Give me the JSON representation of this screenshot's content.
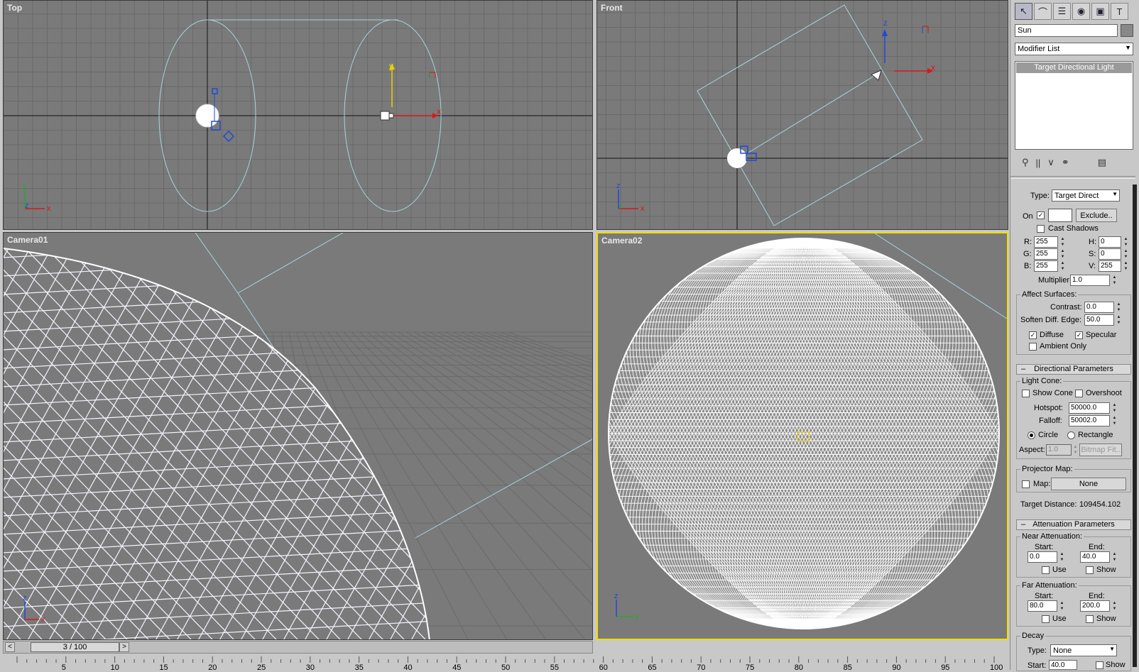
{
  "viewports": {
    "top": {
      "label": "Top"
    },
    "front": {
      "label": "Front"
    },
    "camera01": {
      "label": "Camera01"
    },
    "camera02": {
      "label": "Camera02"
    }
  },
  "axes": {
    "x": "x",
    "y": "y",
    "z": "z"
  },
  "command_panel": {
    "tabs": [
      "create-icon",
      "modify-icon",
      "hierarchy-icon",
      "motion-icon",
      "display-icon",
      "utilities-icon"
    ],
    "object_name": "Sun",
    "modifier_list": "Modifier List",
    "stack_item": "Target Directional Light"
  },
  "general_params": {
    "type_label": "Type:",
    "type_value": "Target Direct",
    "on_label": "On",
    "exclude_button": "Exclude..",
    "cast_shadows": "Cast Shadows",
    "r_label": "R:",
    "r": "255",
    "g_label": "G:",
    "g": "255",
    "b_label": "B:",
    "b": "255",
    "h_label": "H:",
    "h": "0",
    "s_label": "S:",
    "s": "0",
    "v_label": "V:",
    "v": "255",
    "multiplier_label": "Multiplier:",
    "multiplier": "1.0",
    "affect_surfaces": "Affect Surfaces:",
    "contrast_label": "Contrast:",
    "contrast": "0.0",
    "soften_label": "Soften Diff. Edge:",
    "soften": "50.0",
    "diffuse": "Diffuse",
    "specular": "Specular",
    "ambient_only": "Ambient Only"
  },
  "directional_params": {
    "header": "Directional Parameters",
    "light_cone": "Light Cone:",
    "show_cone": "Show Cone",
    "overshoot": "Overshoot",
    "hotspot_label": "Hotspot:",
    "hotspot": "50000.0",
    "falloff_label": "Falloff:",
    "falloff": "50002.0",
    "circle": "Circle",
    "rectangle": "Rectangle",
    "aspect_label": "Aspect:",
    "aspect": "1.0",
    "bitmap_fit": "Bitmap Fit..",
    "projector_map": "Projector Map:",
    "map_label": "Map:",
    "map_value": "None",
    "target_distance_label": "Target Distance:",
    "target_distance": "109454.102"
  },
  "attenuation_params": {
    "header": "Attenuation Parameters",
    "near": "Near Attenuation:",
    "far": "Far Attenuation:",
    "start_label": "Start:",
    "end_label": "End:",
    "near_start": "0.0",
    "near_end": "40.0",
    "far_start": "80.0",
    "far_end": "200.0",
    "use": "Use",
    "show": "Show",
    "decay": "Decay",
    "decay_type_label": "Type:",
    "decay_type": "None",
    "decay_start_label": "Start:",
    "decay_start": "40.0"
  },
  "timeline": {
    "frame_display": "3 / 100",
    "prev": "<",
    "next": ">",
    "current_frame": 3,
    "total_frames": 100,
    "tick_labels": [
      "5",
      "10",
      "15",
      "20",
      "25",
      "30",
      "35",
      "40",
      "45",
      "50",
      "55",
      "60",
      "65",
      "70",
      "75",
      "80",
      "85",
      "90",
      "95",
      "100"
    ]
  }
}
